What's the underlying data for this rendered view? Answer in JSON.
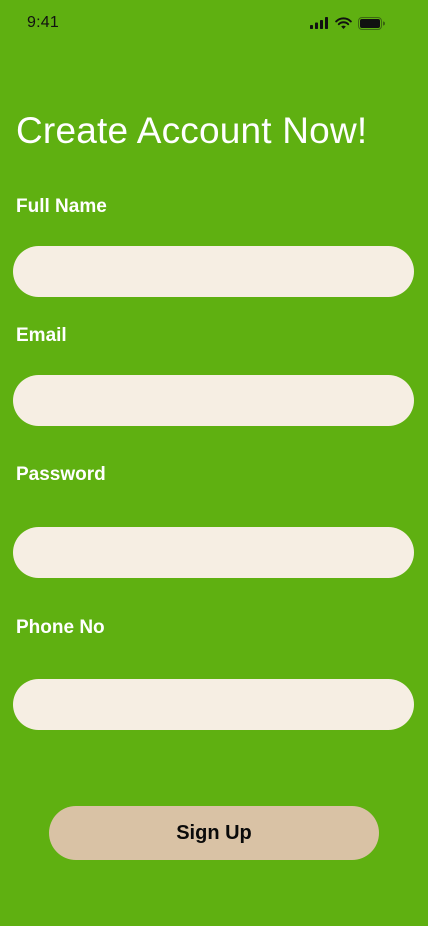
{
  "status_bar": {
    "time": "9:41",
    "icons": [
      "cellular-signal-icon",
      "wifi-icon",
      "battery-icon"
    ]
  },
  "title": "Create Account Now!",
  "form": {
    "full_name": {
      "label": "Full Name",
      "value": "",
      "placeholder": ""
    },
    "email": {
      "label": "Email",
      "value": "",
      "placeholder": ""
    },
    "password": {
      "label": "Password",
      "value": "",
      "placeholder": ""
    },
    "phone": {
      "label": "Phone No",
      "value": "",
      "placeholder": ""
    }
  },
  "submit_label": "Sign Up",
  "colors": {
    "background": "#5FB011",
    "input_background": "#F6EEE3",
    "button_background": "#D9C2A5",
    "label_text": "#FFFFFF",
    "button_text": "#0A0A0A"
  }
}
